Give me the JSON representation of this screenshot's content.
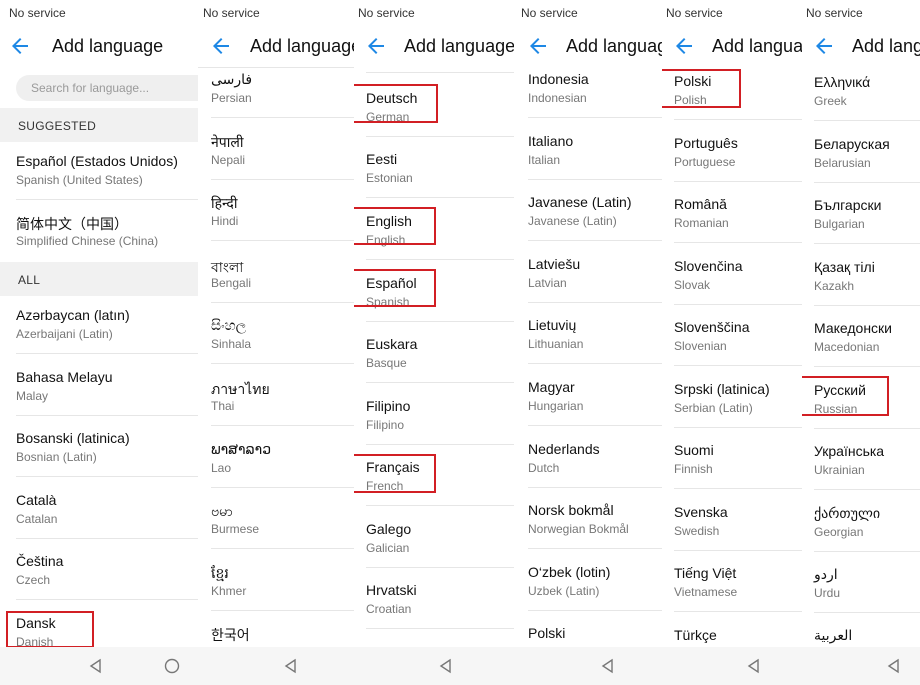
{
  "status_text": "No service",
  "title": "Add language",
  "search_placeholder": "Search for language...",
  "sections": {
    "suggested": "SUGGESTED",
    "all": "ALL"
  },
  "accent_color": "#1e88e5",
  "highlight_color": "#d21f24",
  "panels": [
    {
      "suggested": [
        {
          "name": "Español (Estados Unidos)",
          "sub": "Spanish (United States)"
        },
        {
          "name": "简体中文（中国）",
          "sub": "Simplified Chinese (China)"
        }
      ],
      "items": [
        {
          "name": "Azərbaycan (latın)",
          "sub": "Azerbaijani (Latin)"
        },
        {
          "name": "Bahasa Melayu",
          "sub": "Malay"
        },
        {
          "name": "Bosanski (latinica)",
          "sub": "Bosnian (Latin)"
        },
        {
          "name": "Català",
          "sub": "Catalan"
        },
        {
          "name": "Čeština",
          "sub": "Czech"
        },
        {
          "name": "Dansk",
          "sub": "Danish"
        }
      ]
    },
    {
      "items": [
        {
          "name": "فارسی",
          "sub": "Persian"
        },
        {
          "name": "नेपाली",
          "sub": "Nepali"
        },
        {
          "name": "हिन्दी",
          "sub": "Hindi"
        },
        {
          "name": "বাংলা",
          "sub": "Bengali"
        },
        {
          "name": "සිංහල",
          "sub": "Sinhala"
        },
        {
          "name": "ภาษาไทย",
          "sub": "Thai"
        },
        {
          "name": "ພາສາລາວ",
          "sub": "Lao"
        },
        {
          "name": "ဗမာ",
          "sub": "Burmese"
        },
        {
          "name": "ខ្មែរ",
          "sub": "Khmer"
        },
        {
          "name": "한국어",
          "sub": ""
        }
      ]
    },
    {
      "items": [
        {
          "name": "Deutsch",
          "sub": "German"
        },
        {
          "name": "Eesti",
          "sub": "Estonian"
        },
        {
          "name": "English",
          "sub": "English"
        },
        {
          "name": "Español",
          "sub": "Spanish"
        },
        {
          "name": "Euskara",
          "sub": "Basque"
        },
        {
          "name": "Filipino",
          "sub": "Filipino"
        },
        {
          "name": "Français",
          "sub": "French"
        },
        {
          "name": "Galego",
          "sub": "Galician"
        },
        {
          "name": "Hrvatski",
          "sub": "Croatian"
        }
      ]
    },
    {
      "items": [
        {
          "name": "Indonesia",
          "sub": "Indonesian"
        },
        {
          "name": "Italiano",
          "sub": "Italian"
        },
        {
          "name": "Javanese (Latin)",
          "sub": "Javanese (Latin)"
        },
        {
          "name": "Latviešu",
          "sub": "Latvian"
        },
        {
          "name": "Lietuvių",
          "sub": "Lithuanian"
        },
        {
          "name": "Magyar",
          "sub": "Hungarian"
        },
        {
          "name": "Nederlands",
          "sub": "Dutch"
        },
        {
          "name": "Norsk bokmål",
          "sub": "Norwegian Bokmål"
        },
        {
          "name": "O‘zbek (lotin)",
          "sub": "Uzbek (Latin)"
        },
        {
          "name": "Polski",
          "sub": ""
        }
      ]
    },
    {
      "items": [
        {
          "name": "Polski",
          "sub": "Polish"
        },
        {
          "name": "Português",
          "sub": "Portuguese"
        },
        {
          "name": "Română",
          "sub": "Romanian"
        },
        {
          "name": "Slovenčina",
          "sub": "Slovak"
        },
        {
          "name": "Slovenščina",
          "sub": "Slovenian"
        },
        {
          "name": "Srpski (latinica)",
          "sub": "Serbian (Latin)"
        },
        {
          "name": "Suomi",
          "sub": "Finnish"
        },
        {
          "name": "Svenska",
          "sub": "Swedish"
        },
        {
          "name": "Tiếng Việt",
          "sub": "Vietnamese"
        },
        {
          "name": "Türkçe",
          "sub": ""
        }
      ]
    },
    {
      "items": [
        {
          "name": "Ελληνικά",
          "sub": "Greek"
        },
        {
          "name": "Беларуская",
          "sub": "Belarusian"
        },
        {
          "name": "Български",
          "sub": "Bulgarian"
        },
        {
          "name": "Қазақ тілі",
          "sub": "Kazakh"
        },
        {
          "name": "Македонски",
          "sub": "Macedonian"
        },
        {
          "name": "Русский",
          "sub": "Russian"
        },
        {
          "name": "Українська",
          "sub": "Ukrainian"
        },
        {
          "name": "ქართული",
          "sub": "Georgian"
        },
        {
          "name": "اردو",
          "sub": "Urdu"
        },
        {
          "name": "العربية",
          "sub": ""
        }
      ]
    }
  ]
}
